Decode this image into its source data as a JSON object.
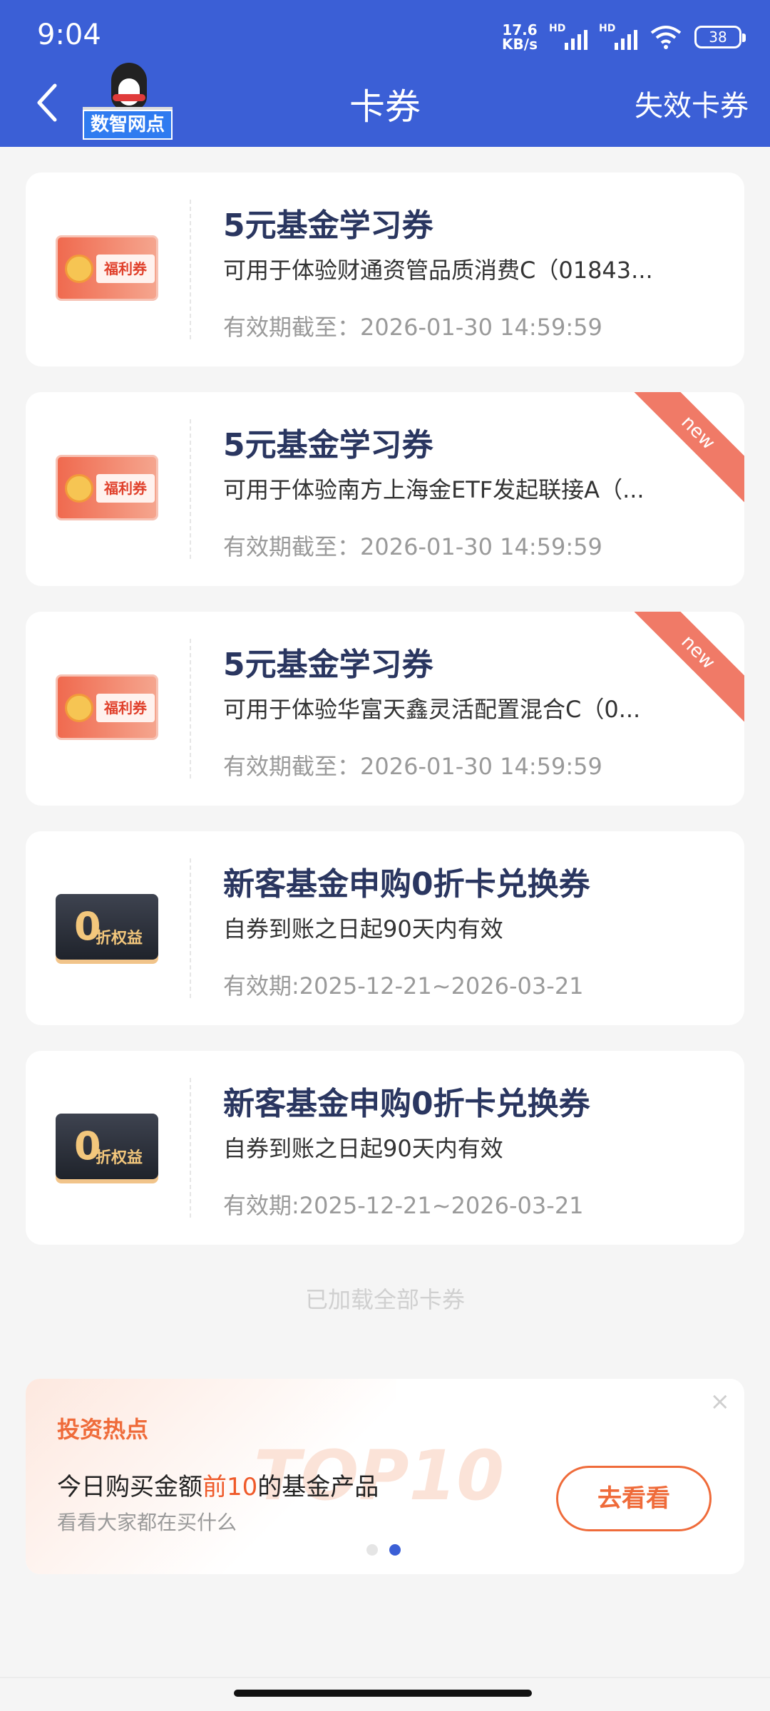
{
  "status": {
    "time": "9:04",
    "net_speed_value": "17.6",
    "net_speed_unit": "KB/s",
    "signal_1": "HD",
    "signal_2": "HD",
    "battery": "38"
  },
  "header": {
    "logo_text": "数智网点",
    "title": "卡券",
    "right_link": "失效卡券"
  },
  "coupons": [
    {
      "thumb_label": "福利券",
      "title": "5元基金学习券",
      "desc": "可用于体验财通资管品质消费C（01843...",
      "validity": "有效期截至：2026-01-30 14:59:59"
    },
    {
      "thumb_label": "福利券",
      "title": "5元基金学习券",
      "desc": "可用于体验南方上海金ETF发起联接A（...",
      "validity": "有效期截至：2026-01-30 14:59:59",
      "badge": "new"
    },
    {
      "thumb_label": "福利券",
      "title": "5元基金学习券",
      "desc": "可用于体验华富天鑫灵活配置混合C（0...",
      "validity": "有效期截至：2026-01-30 14:59:59",
      "badge": "new"
    },
    {
      "thumb_zero": "0",
      "thumb_label": "折权益",
      "title": "新客基金申购0折卡兑换券",
      "desc": "自券到账之日起90天内有效",
      "validity": "有效期:2025-12-21~2026-03-21"
    },
    {
      "thumb_zero": "0",
      "thumb_label": "折权益",
      "title": "新客基金申购0折卡兑换券",
      "desc": "自券到账之日起90天内有效",
      "validity": "有效期:2025-12-21~2026-03-21"
    }
  ],
  "end_text": "已加载全部卡券",
  "promo": {
    "category": "投资热点",
    "headline_pre": "今日购买金额",
    "headline_hl": "前10",
    "headline_post": "的基金产品",
    "sub": "看看大家都在买什么",
    "cta": "去看看",
    "bg_text": "TOP10",
    "close": "×"
  },
  "colors": {
    "header": "#3b5fd6",
    "accent_orange": "#ef6b3a",
    "ribbon": "#f07a67",
    "title_navy": "#2a3660"
  },
  "icons": {
    "back": "chevron-left-icon",
    "wifi": "wifi-icon",
    "close": "close-icon"
  }
}
